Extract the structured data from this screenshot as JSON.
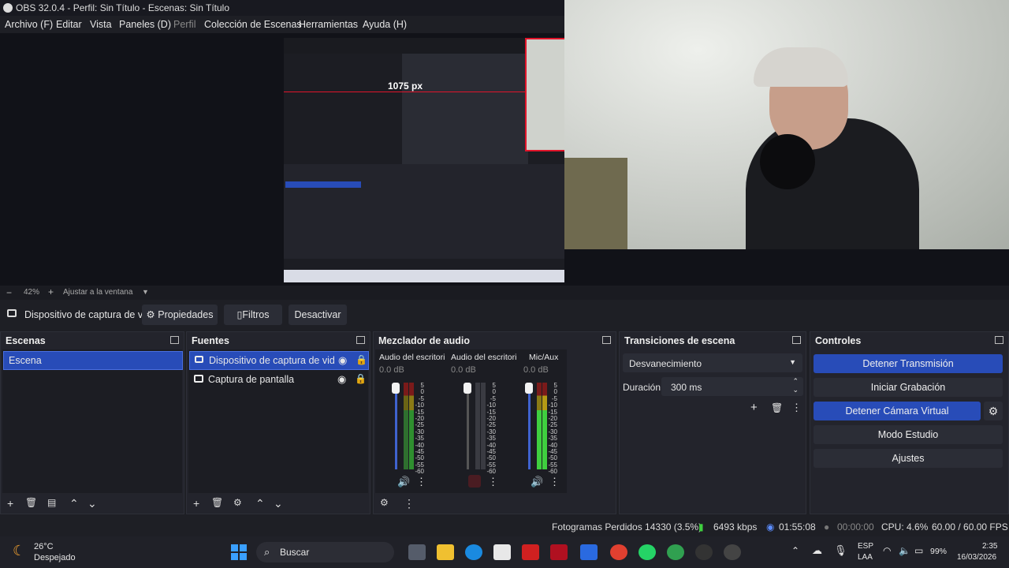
{
  "window": {
    "title": "OBS 32.0.4 - Perfil: Sin Título - Escenas: Sin Título"
  },
  "menu": [
    "Archivo (F)",
    "Editar",
    "Vista",
    "Paneles (D)",
    "Perfil",
    "Colección de Escenas",
    "Herramientas",
    "Ayuda (H)"
  ],
  "preview": {
    "measure_label": "1075 px"
  },
  "zoom": {
    "minus": "−",
    "level": "42%",
    "plus": "+",
    "fit_label": "Ajustar a la ventana"
  },
  "source_toolbar": {
    "source_name": "Dispositivo de captura de v",
    "properties": "Propiedades",
    "filters": "Filtros",
    "deactivate": "Desactivar"
  },
  "scenes": {
    "title": "Escenas",
    "items": [
      "Escena"
    ]
  },
  "sources": {
    "title": "Fuentes",
    "items": [
      "Dispositivo de captura de video",
      "Captura de pantalla"
    ]
  },
  "mixer": {
    "title": "Mezclador de audio",
    "channels": [
      {
        "name": "Audio del escritorio",
        "db": "0.0 dB",
        "muted": false
      },
      {
        "name": "Audio del escritorio",
        "db": "0.0 dB",
        "muted": true
      },
      {
        "name": "Mic/Aux",
        "db": "0.0 dB",
        "muted": false
      }
    ],
    "scale": [
      "5",
      "0",
      "-5",
      "-10",
      "-15",
      "-20",
      "-25",
      "-30",
      "-35",
      "-40",
      "-45",
      "-50",
      "-55",
      "-60"
    ]
  },
  "transitions": {
    "title": "Transiciones de escena",
    "selected": "Desvanecimiento",
    "duration_label": "Duración",
    "duration_value": "300 ms"
  },
  "controls": {
    "title": "Controles",
    "buttons": [
      "Detener Transmisión",
      "Iniciar Grabación",
      "Detener Cámara Virtual",
      "Modo Estudio",
      "Ajustes"
    ]
  },
  "status": {
    "dropped": "Fotogramas Perdidos 14330 (3.5%)",
    "bitrate": "6493 kbps",
    "stream_time": "01:55:08",
    "rec_time": "00:00:00",
    "cpu": "CPU: 4.6%",
    "fps": "60.00 / 60.00 FPS"
  },
  "taskbar": {
    "weather_temp": "26°C",
    "weather_desc": "Despejado",
    "search": "Buscar",
    "lang1": "ESP",
    "lang2": "LAA",
    "battery": "99%",
    "time": "2:35",
    "date": "16/03/2026"
  },
  "colors": {
    "accent": "#284cb8",
    "bg": "#1e1f25",
    "dock": "#23242c"
  }
}
